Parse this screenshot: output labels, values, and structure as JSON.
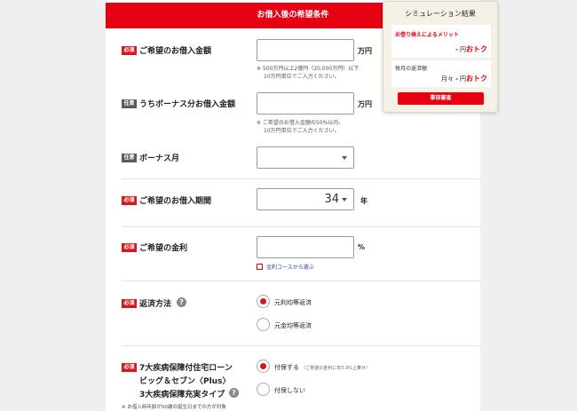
{
  "header": {
    "title": "お借入後の希望条件"
  },
  "fields": {
    "amount": {
      "badge": "必須",
      "label": "ご希望のお借入金額",
      "unit": "万円",
      "value": "",
      "note1": "※ 500万円以上2億円（20,000万円）以下",
      "note2": "10万円単位でご入力ください。"
    },
    "bonus_amount": {
      "badge": "任意",
      "label": "うちボーナス分お借入金額",
      "unit": "万円",
      "value": "",
      "note1": "※ ご希望のお借入金額の50%以内、",
      "note2": "10万円単位でご入力ください。"
    },
    "bonus_month": {
      "badge": "任意",
      "label": "ボーナス月",
      "value": ""
    },
    "term": {
      "badge": "必須",
      "label": "ご希望のお借入期間",
      "value": "34",
      "unit": "年"
    },
    "rate": {
      "badge": "必須",
      "label": "ご希望の金利",
      "unit": "%",
      "value": "",
      "link": "金利コースから選ぶ"
    },
    "repayment": {
      "badge": "必須",
      "label": "返済方法",
      "options": [
        "元利均等返済",
        "元金均等返済"
      ],
      "selected": 0
    },
    "insurance": {
      "badge": "必須",
      "label_line1": "7大疾病保障付住宅ローン",
      "label_line2": "ビッグ＆セブン〈Plus〉",
      "label_line3": "3大疾病保障充実タイプ",
      "options": [
        "付保する",
        "付保しない"
      ],
      "option_note": "（ご希望の金利に年0.3%上乗せ）",
      "selected": 0,
      "footnote": "※ お借入時年齢が50歳の誕生日までの方が対象"
    }
  },
  "simulation": {
    "title": "シミュレーション結果",
    "merit_label": "お借り換えによるメリット",
    "merit_value_dash": "-",
    "merit_value_unit": "円",
    "merit_value_otoku": "おトク",
    "monthly_label": "毎月の返済額",
    "monthly_prefix": "月々",
    "monthly_value_dash": "-",
    "monthly_value_unit": "円",
    "monthly_value_otoku": "おトク",
    "button_label": "事前審査"
  },
  "colors": {
    "accent": "#e60012",
    "badge_optional": "#5a5a5a",
    "link": "#2a4b9b"
  }
}
